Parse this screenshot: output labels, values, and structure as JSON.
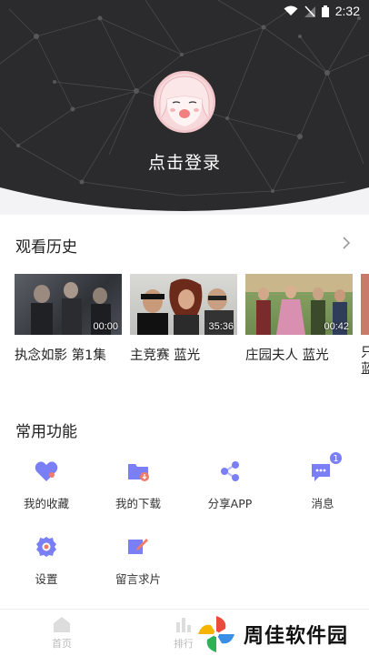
{
  "status": {
    "time": "2:32"
  },
  "profile": {
    "login_label": "点击登录"
  },
  "history": {
    "title": "观看历史",
    "items": [
      {
        "title": "执念如影 第1集",
        "duration": "00:00"
      },
      {
        "title": "主竞赛 蓝光",
        "duration": "35:36"
      },
      {
        "title": "庄园夫人 蓝光",
        "duration": "00:42"
      },
      {
        "title": "只蓝",
        "duration": ""
      }
    ]
  },
  "functions": {
    "title": "常用功能",
    "items": [
      {
        "label": "我的收藏",
        "icon": "heart-folder-icon"
      },
      {
        "label": "我的下载",
        "icon": "download-folder-icon"
      },
      {
        "label": "分享APP",
        "icon": "share-icon"
      },
      {
        "label": "消息",
        "icon": "message-icon",
        "badge": "1"
      },
      {
        "label": "设置",
        "icon": "gear-icon"
      },
      {
        "label": "留言求片",
        "icon": "feedback-icon"
      }
    ]
  },
  "tabbar": {
    "items": [
      {
        "label": "首页"
      },
      {
        "label": "排行"
      }
    ]
  },
  "watermark": {
    "text": "周佳软件园"
  },
  "colors": {
    "accent": "#7b7ff5",
    "accent_light": "#b7b9fa",
    "badge": "#7b7ff5",
    "header_bg": "#2b2b2d"
  }
}
